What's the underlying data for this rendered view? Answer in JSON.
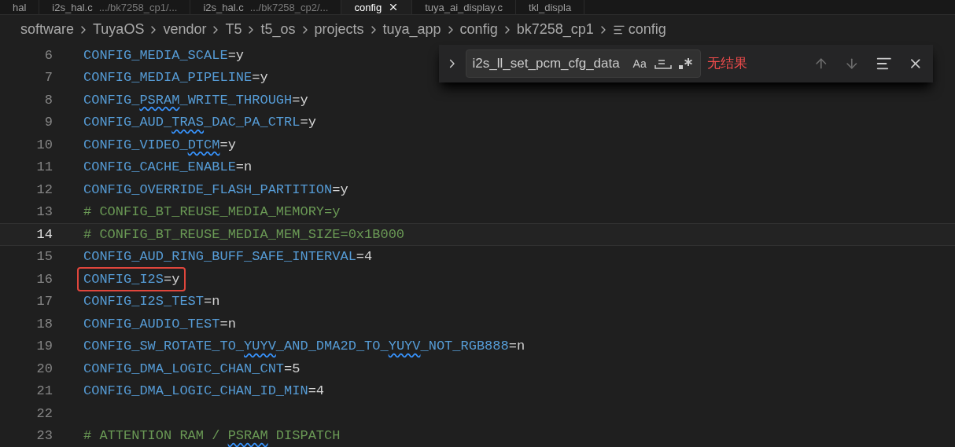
{
  "tabs": [
    {
      "name": "hal",
      "selected": false,
      "closable": false
    },
    {
      "name": "i2s_hal.c",
      "path": ".../bk7258_cp1/...",
      "selected": false,
      "closable": false
    },
    {
      "name": "i2s_hal.c",
      "path": ".../bk7258_cp2/...",
      "selected": false,
      "closable": false
    },
    {
      "name": "config",
      "selected": true,
      "closable": true
    },
    {
      "name": "tuya_ai_display.c",
      "selected": false,
      "closable": false
    },
    {
      "name": "tkl_displa",
      "selected": false,
      "closable": false
    }
  ],
  "breadcrumb": [
    "software",
    "TuyaOS",
    "vendor",
    "T5",
    "t5_os",
    "projects",
    "tuya_app",
    "config",
    "bk7258_cp1",
    "config"
  ],
  "find": {
    "value": "i2s_ll_set_pcm_cfg_data",
    "message": "无结果",
    "match_case_label": "Aa",
    "match_case": false,
    "whole_word": false,
    "regex": false
  },
  "lines": [
    {
      "number": "6",
      "current": false,
      "boxed": false,
      "segments": [
        {
          "kind": "key",
          "text": "CONFIG_MEDIA_SCALE",
          "squiggle": false
        },
        {
          "kind": "value",
          "text": "=y",
          "squiggle": false
        }
      ]
    },
    {
      "number": "7",
      "current": false,
      "boxed": false,
      "segments": [
        {
          "kind": "key",
          "text": "CONFIG_MEDIA_PIPELINE",
          "squiggle": false
        },
        {
          "kind": "value",
          "text": "=y",
          "squiggle": false
        }
      ]
    },
    {
      "number": "8",
      "current": false,
      "boxed": false,
      "segments": [
        {
          "kind": "key",
          "text": "CONFIG_",
          "squiggle": false
        },
        {
          "kind": "key",
          "text": "PSRAM",
          "squiggle": true
        },
        {
          "kind": "key",
          "text": "_WRITE_THROUGH",
          "squiggle": false
        },
        {
          "kind": "value",
          "text": "=y",
          "squiggle": false
        }
      ]
    },
    {
      "number": "9",
      "current": false,
      "boxed": false,
      "segments": [
        {
          "kind": "key",
          "text": "CONFIG_AUD_",
          "squiggle": false
        },
        {
          "kind": "key",
          "text": "TRAS",
          "squiggle": true
        },
        {
          "kind": "key",
          "text": "_DAC_PA_CTRL",
          "squiggle": false
        },
        {
          "kind": "value",
          "text": "=y",
          "squiggle": false
        }
      ]
    },
    {
      "number": "10",
      "current": false,
      "boxed": false,
      "segments": [
        {
          "kind": "key",
          "text": "CONFIG_VIDEO_",
          "squiggle": false
        },
        {
          "kind": "key",
          "text": "DTCM",
          "squiggle": true
        },
        {
          "kind": "value",
          "text": "=y",
          "squiggle": false
        }
      ]
    },
    {
      "number": "11",
      "current": false,
      "boxed": false,
      "segments": [
        {
          "kind": "key",
          "text": "CONFIG_CACHE_ENABLE",
          "squiggle": false
        },
        {
          "kind": "value",
          "text": "=n",
          "squiggle": false
        }
      ]
    },
    {
      "number": "12",
      "current": false,
      "boxed": false,
      "segments": [
        {
          "kind": "key",
          "text": "CONFIG_OVERRIDE_FLASH_PARTITION",
          "squiggle": false
        },
        {
          "kind": "value",
          "text": "=y",
          "squiggle": false
        }
      ]
    },
    {
      "number": "13",
      "current": false,
      "boxed": false,
      "segments": [
        {
          "kind": "comment",
          "text": "# CONFIG_BT_REUSE_MEDIA_MEMORY=y",
          "squiggle": false
        }
      ]
    },
    {
      "number": "14",
      "current": true,
      "boxed": false,
      "segments": [
        {
          "kind": "comment",
          "text": "# CONFIG_BT_REUSE_MEDIA_MEM_SIZE=0x1B000",
          "squiggle": false
        }
      ]
    },
    {
      "number": "15",
      "current": false,
      "boxed": false,
      "segments": [
        {
          "kind": "key",
          "text": "CONFIG_AUD_RING_BUFF_SAFE_INTERVAL",
          "squiggle": false
        },
        {
          "kind": "value",
          "text": "=4",
          "squiggle": false
        }
      ]
    },
    {
      "number": "16",
      "current": false,
      "boxed": true,
      "segments": [
        {
          "kind": "key",
          "text": "CONFIG_I2S",
          "squiggle": false
        },
        {
          "kind": "value",
          "text": "=y",
          "squiggle": false
        }
      ]
    },
    {
      "number": "17",
      "current": false,
      "boxed": false,
      "segments": [
        {
          "kind": "key",
          "text": "CONFIG_I2S_TEST",
          "squiggle": false
        },
        {
          "kind": "value",
          "text": "=n",
          "squiggle": false
        }
      ]
    },
    {
      "number": "18",
      "current": false,
      "boxed": false,
      "segments": [
        {
          "kind": "key",
          "text": "CONFIG_AUDIO_TEST",
          "squiggle": false
        },
        {
          "kind": "value",
          "text": "=n",
          "squiggle": false
        }
      ]
    },
    {
      "number": "19",
      "current": false,
      "boxed": false,
      "segments": [
        {
          "kind": "key",
          "text": "CONFIG_SW_ROTATE_TO_",
          "squiggle": false
        },
        {
          "kind": "key",
          "text": "YUYV",
          "squiggle": true
        },
        {
          "kind": "key",
          "text": "_AND_DMA2D_TO_",
          "squiggle": false
        },
        {
          "kind": "key",
          "text": "YUYV",
          "squiggle": true
        },
        {
          "kind": "key",
          "text": "_NOT_RGB888",
          "squiggle": false
        },
        {
          "kind": "value",
          "text": "=n",
          "squiggle": false
        }
      ]
    },
    {
      "number": "20",
      "current": false,
      "boxed": false,
      "segments": [
        {
          "kind": "key",
          "text": "CONFIG_DMA_LOGIC_CHAN_CNT",
          "squiggle": false
        },
        {
          "kind": "value",
          "text": "=5",
          "squiggle": false
        }
      ]
    },
    {
      "number": "21",
      "current": false,
      "boxed": false,
      "segments": [
        {
          "kind": "key",
          "text": "CONFIG_DMA_LOGIC_CHAN_ID_MIN",
          "squiggle": false
        },
        {
          "kind": "value",
          "text": "=4",
          "squiggle": false
        }
      ]
    },
    {
      "number": "22",
      "current": false,
      "boxed": false
    },
    {
      "number": "23",
      "current": false,
      "boxed": false,
      "segments": [
        {
          "kind": "comment",
          "text": "# ATTENTION RAM / ",
          "squiggle": false
        },
        {
          "kind": "comment",
          "text": "PSRAM",
          "squiggle": true
        },
        {
          "kind": "comment",
          "text": " DISPATCH",
          "squiggle": false
        }
      ]
    }
  ]
}
